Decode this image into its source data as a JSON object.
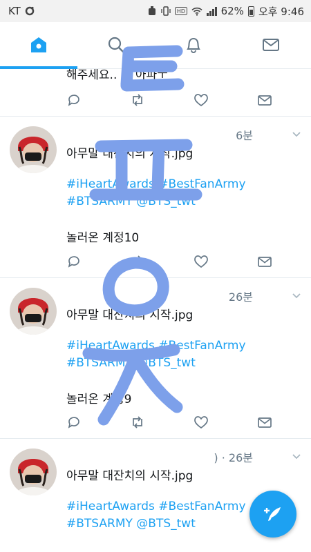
{
  "statusbar": {
    "carrier": "KT",
    "battery": "62%",
    "clock": "오후 9:46"
  },
  "tabs": [
    {
      "name": "home",
      "icon": "home-icon",
      "active": true
    },
    {
      "name": "search",
      "icon": "search-icon",
      "active": false
    },
    {
      "name": "notifications",
      "icon": "bell-icon",
      "active": false
    },
    {
      "name": "messages",
      "icon": "mail-icon",
      "active": false
    }
  ],
  "tweets": [
    {
      "partial_text": "해주세요.. 이 아파ㅜ"
    },
    {
      "time": "6분",
      "text": "아무말 대잔치의 시작.jpg",
      "hashtags": "#iHeartAwards #BestFanArmy",
      "hashtags2": "#BTSARMY @BTS_twt",
      "note": "놀러온 계정10"
    },
    {
      "time": "26분",
      "text": "아무말 대잔치의 시작.jpg",
      "hashtags": "#iHeartAwards #BestFanArmy",
      "hashtags2": "#BTSARMY @BTS_twt",
      "note": "놀러온 계정9"
    },
    {
      "time": ") · 26분",
      "text": "아무말 대잔치의 시작.jpg",
      "hashtags": "#iHeartAwards #BestFanArmy",
      "hashtags2": "#BTSARMY @BTS_twt"
    }
  ],
  "colors": {
    "accent": "#1da1f2",
    "overlay_stroke": "#7da0ea"
  },
  "overlay_handwriting": "ㅌㅍㅇㅈ"
}
